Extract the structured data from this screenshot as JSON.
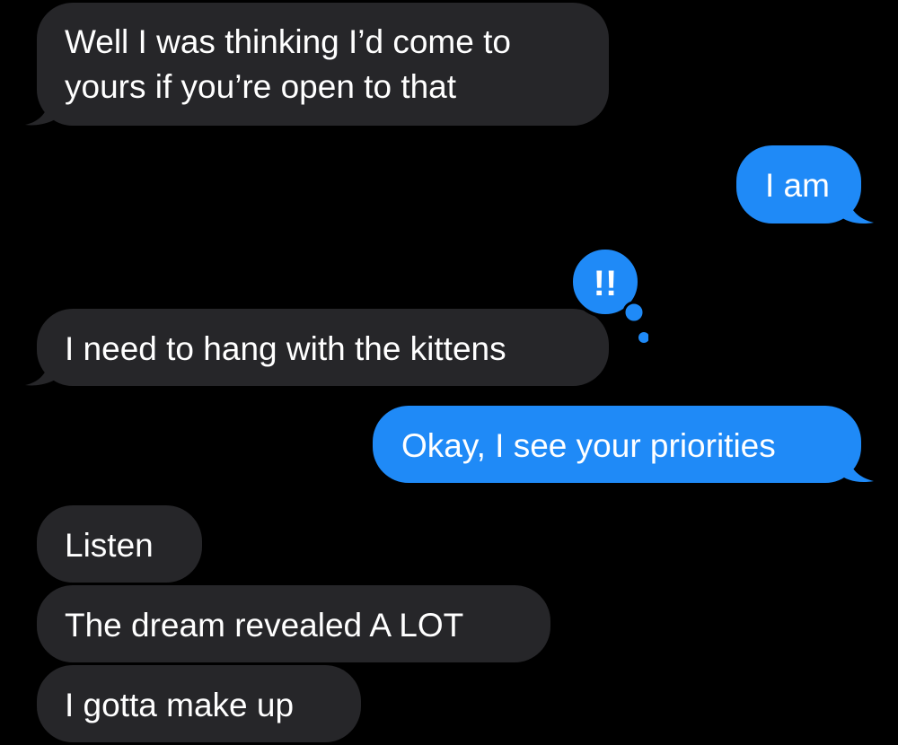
{
  "conversation": {
    "messages": [
      {
        "direction": "incoming",
        "lines": [
          "Well I was thinking I’d come to",
          "yours if you’re open to that"
        ]
      },
      {
        "direction": "outgoing",
        "text": "I am"
      },
      {
        "direction": "incoming",
        "text": "I need to hang with the kittens",
        "reaction": {
          "glyph": "!!",
          "icon": "exclamation-tapback-icon"
        }
      },
      {
        "direction": "outgoing",
        "text": "Okay, I see your priorities"
      },
      {
        "direction": "incoming",
        "text": "Listen"
      },
      {
        "direction": "incoming",
        "text": "The dream revealed A LOT"
      },
      {
        "direction": "incoming",
        "text": "I gotta make up"
      }
    ]
  },
  "colors": {
    "background": "#000000",
    "incoming_bubble": "#262629",
    "outgoing_bubble": "#1f8af7",
    "text": "#ffffff"
  }
}
